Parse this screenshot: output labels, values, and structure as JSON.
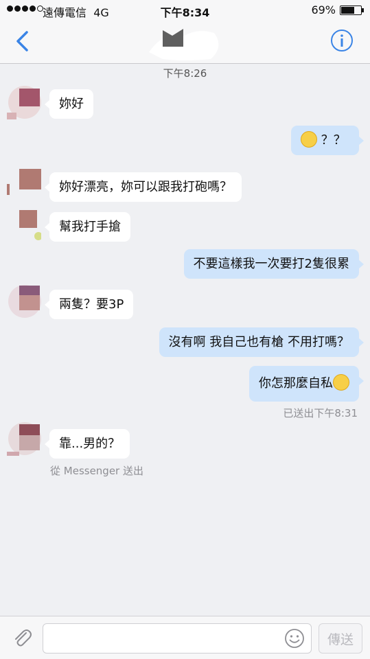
{
  "status_bar": {
    "carrier": "遠傳電信",
    "network": "4G",
    "time": "下午8:34",
    "battery_percent": "69%",
    "battery_level": 0.69
  },
  "header": {
    "back_icon": "chevron-left-icon",
    "info_icon": "info-circle-icon",
    "accent_color": "#3a84e6"
  },
  "conversation": {
    "time_separator": "下午8:26",
    "messages": [
      {
        "side": "in",
        "text": "妳好"
      },
      {
        "side": "out",
        "text": "？？",
        "emoji": "flushed-face-emoji"
      },
      {
        "side": "in",
        "text": "妳好漂亮，妳可以跟我打砲嗎？"
      },
      {
        "side": "in",
        "text": "幫我打手搶"
      },
      {
        "side": "out",
        "text": "不要這樣我一次要打2隻很累"
      },
      {
        "side": "in",
        "text": "兩隻？要3P"
      },
      {
        "side": "out",
        "text": "沒有啊 我自己也有槍 不用打嗎？"
      },
      {
        "side": "out",
        "text": "你怎那麼自私",
        "emoji": "unamused-face-emoji"
      },
      {
        "side": "in",
        "text": "靠...男的？"
      }
    ],
    "sent_status": "已送出下午8:31",
    "via_messenger": "從 Messenger 送出"
  },
  "composer": {
    "placeholder": "",
    "send_label": "傳送",
    "attach_icon": "paperclip-icon",
    "emoji_icon": "smiley-icon"
  },
  "colors": {
    "incoming_bubble": "#ffffff",
    "outgoing_bubble": "#cfe4fb",
    "background": "#eff0f3"
  }
}
